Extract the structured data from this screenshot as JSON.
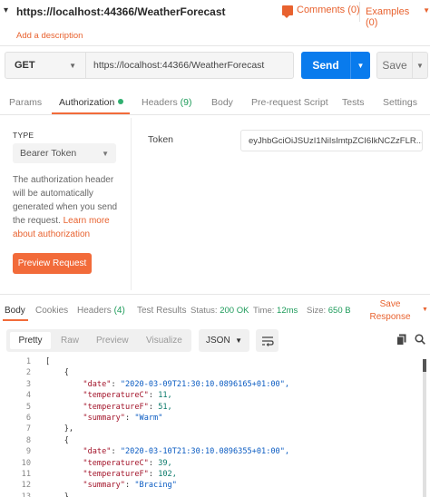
{
  "header": {
    "url_title": "https://localhost:44366/WeatherForecast",
    "comments": "Comments (0)",
    "examples": "Examples (0)",
    "add_description": "Add a description"
  },
  "request": {
    "method": "GET",
    "url": "https://localhost:44366/WeatherForecast",
    "send": "Send",
    "save": "Save"
  },
  "tabs": {
    "params": "Params",
    "authorization": "Authorization",
    "headers": "Headers",
    "headers_count": "(9)",
    "body": "Body",
    "prerequest": "Pre-request Script",
    "tests": "Tests",
    "settings": "Settings"
  },
  "auth": {
    "type_label": "TYPE",
    "type_value": "Bearer Token",
    "note": "The authorization header will be automatically generated when you send the request. ",
    "learn_more": "Learn more about authorization",
    "preview_button": "Preview Request",
    "token_label": "Token",
    "token_value": "eyJhbGciOiJSUzI1NiIsImtpZCI6IkNCZzFLR..."
  },
  "response": {
    "tabs": {
      "body": "Body",
      "cookies": "Cookies",
      "headers": "Headers",
      "headers_count": "(4)",
      "test_results": "Test Results"
    },
    "status_label": "Status:",
    "status_value": "200 OK",
    "time_label": "Time:",
    "time_value": "12ms",
    "size_label": "Size:",
    "size_value": "650 B",
    "save_response": "Save Response",
    "formats": {
      "pretty": "Pretty",
      "raw": "Raw",
      "preview": "Preview",
      "visualize": "Visualize",
      "json": "JSON"
    }
  },
  "code": {
    "line_numbers": [
      "1",
      "2",
      "3",
      "4",
      "5",
      "6",
      "7",
      "8",
      "9",
      "10",
      "11",
      "12",
      "13"
    ],
    "lines": [
      [
        "[",
        "",
        "",
        ""
      ],
      [
        "    {",
        "",
        "",
        ""
      ],
      [
        "        ",
        "\"date\"",
        ": ",
        "\"2020-03-09T21:30:10.0896165+01:00\","
      ],
      [
        "        ",
        "\"temperatureC\"",
        ": ",
        "11,"
      ],
      [
        "        ",
        "\"temperatureF\"",
        ": ",
        "51,"
      ],
      [
        "        ",
        "\"summary\"",
        ": ",
        "\"Warm\""
      ],
      [
        "    },",
        "",
        "",
        ""
      ],
      [
        "    {",
        "",
        "",
        ""
      ],
      [
        "        ",
        "\"date\"",
        ": ",
        "\"2020-03-10T21:30:10.0896355+01:00\","
      ],
      [
        "        ",
        "\"temperatureC\"",
        ": ",
        "39,"
      ],
      [
        "        ",
        "\"temperatureF\"",
        ": ",
        "102,"
      ],
      [
        "        ",
        "\"summary\"",
        ": ",
        "\"Bracing\""
      ],
      [
        "    },",
        "",
        "",
        ""
      ]
    ]
  },
  "colors": {
    "accent": "#f26b3a",
    "send_blue": "#097bed",
    "status_green": "#1d9b5a"
  }
}
